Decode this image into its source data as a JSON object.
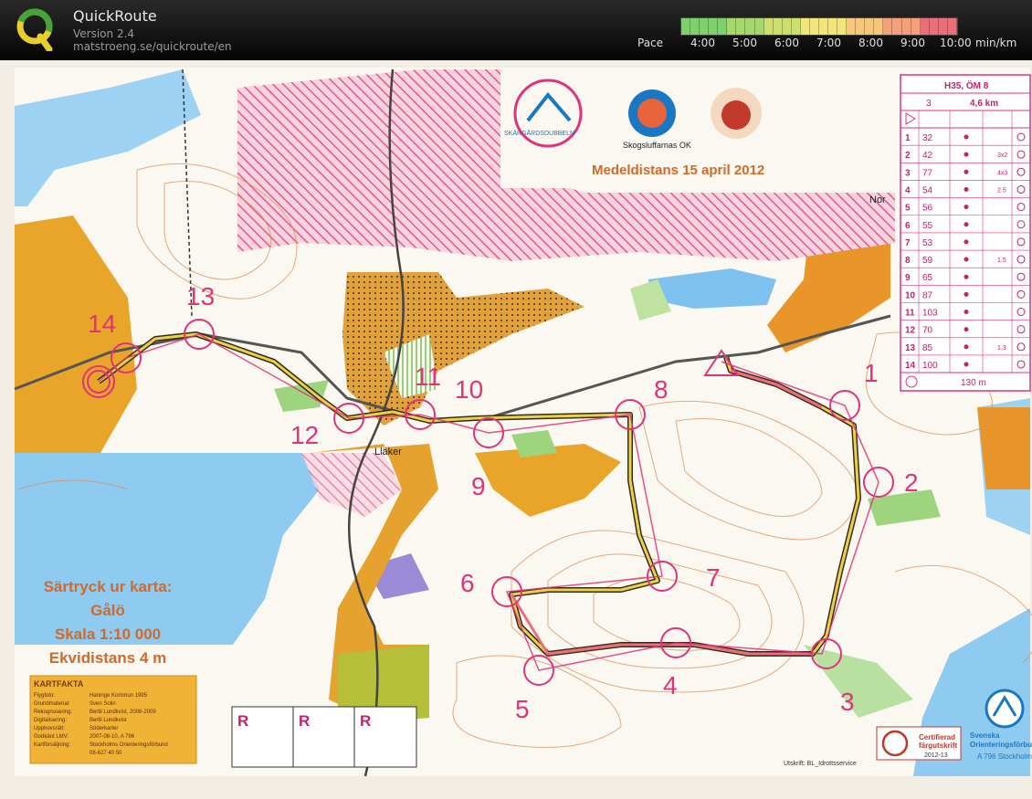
{
  "app": {
    "title": "QuickRoute",
    "version": "Version 2.4",
    "url": "matstroeng.se/quickroute/en"
  },
  "pace_legend": {
    "label": "Pace",
    "ticks": [
      "4:00",
      "5:00",
      "6:00",
      "7:00",
      "8:00",
      "9:00",
      "10:00"
    ],
    "unit": "min/km",
    "colors": [
      "#7fcf70",
      "#a6d66e",
      "#cde06c",
      "#f2e67a",
      "#f7c87a",
      "#f4a07a",
      "#e9707a"
    ]
  },
  "map": {
    "header_text": "Medeldistans 15 april 2012",
    "sponsor_1": "SKÄRGÅRDSDUBBELN",
    "sponsor_2": "Skogsluffarnas OK",
    "place_label": "Lläker",
    "place_label_2": "Nor",
    "print_info": {
      "line1": "Särtryck ur karta:",
      "line2": "Gålö",
      "line3": "Skala 1:10 000",
      "line4": "Ekvidistans 4 m"
    },
    "kartfakta": {
      "title": "KARTFAKTA",
      "rows": [
        [
          "Flygfoto:",
          "Haninge Kommun 1995"
        ],
        [
          "Grundmaterial:",
          "Sven Solin"
        ],
        [
          "Rekognosering:",
          "Bertil Lundkvist, 2006-2009"
        ],
        [
          "Digitalisering:",
          "Bertil Lundkvist"
        ],
        [
          "Upphovsrätt:",
          "Söderkarter"
        ],
        [
          "Godkänt LMV:",
          "2007-08-10, A 796"
        ],
        [
          "Kartförsäljning:",
          "Stockholms Orienteringsförbund"
        ],
        [
          "",
          "08-627 40 50"
        ]
      ]
    },
    "r_boxes": [
      "R",
      "R",
      "R"
    ],
    "printer": "Utskrift: BL_Idrottsservice",
    "certified": {
      "line1": "Certifierad",
      "line2": "färgutskrift",
      "line3": "2012-13"
    },
    "federation": {
      "line1": "Svenska",
      "line2": "Orienteringsförbund",
      "line3": "A 796 Stockholm"
    },
    "control_numbers": [
      "1",
      "2",
      "3",
      "4",
      "5",
      "6",
      "7",
      "8",
      "9",
      "10",
      "11",
      "12",
      "13",
      "14"
    ]
  },
  "control_description": {
    "class": "H35, ÖM 8",
    "controls_count": "3",
    "length": "4,6 km",
    "rows": [
      {
        "n": "1",
        "code": "32",
        "dim": ""
      },
      {
        "n": "2",
        "code": "42",
        "dim": "3x2"
      },
      {
        "n": "3",
        "code": "77",
        "dim": "4x3"
      },
      {
        "n": "4",
        "code": "54",
        "dim": "2.5"
      },
      {
        "n": "5",
        "code": "56",
        "dim": ""
      },
      {
        "n": "6",
        "code": "55",
        "dim": ""
      },
      {
        "n": "7",
        "code": "53",
        "dim": ""
      },
      {
        "n": "8",
        "code": "59",
        "dim": "1.5"
      },
      {
        "n": "9",
        "code": "65",
        "dim": ""
      },
      {
        "n": "10",
        "code": "87",
        "dim": ""
      },
      {
        "n": "11",
        "code": "103",
        "dim": ""
      },
      {
        "n": "12",
        "code": "70",
        "dim": ""
      },
      {
        "n": "13",
        "code": "85",
        "dim": "1.3"
      },
      {
        "n": "14",
        "code": "100",
        "dim": ""
      }
    ],
    "finish": "130 m"
  }
}
